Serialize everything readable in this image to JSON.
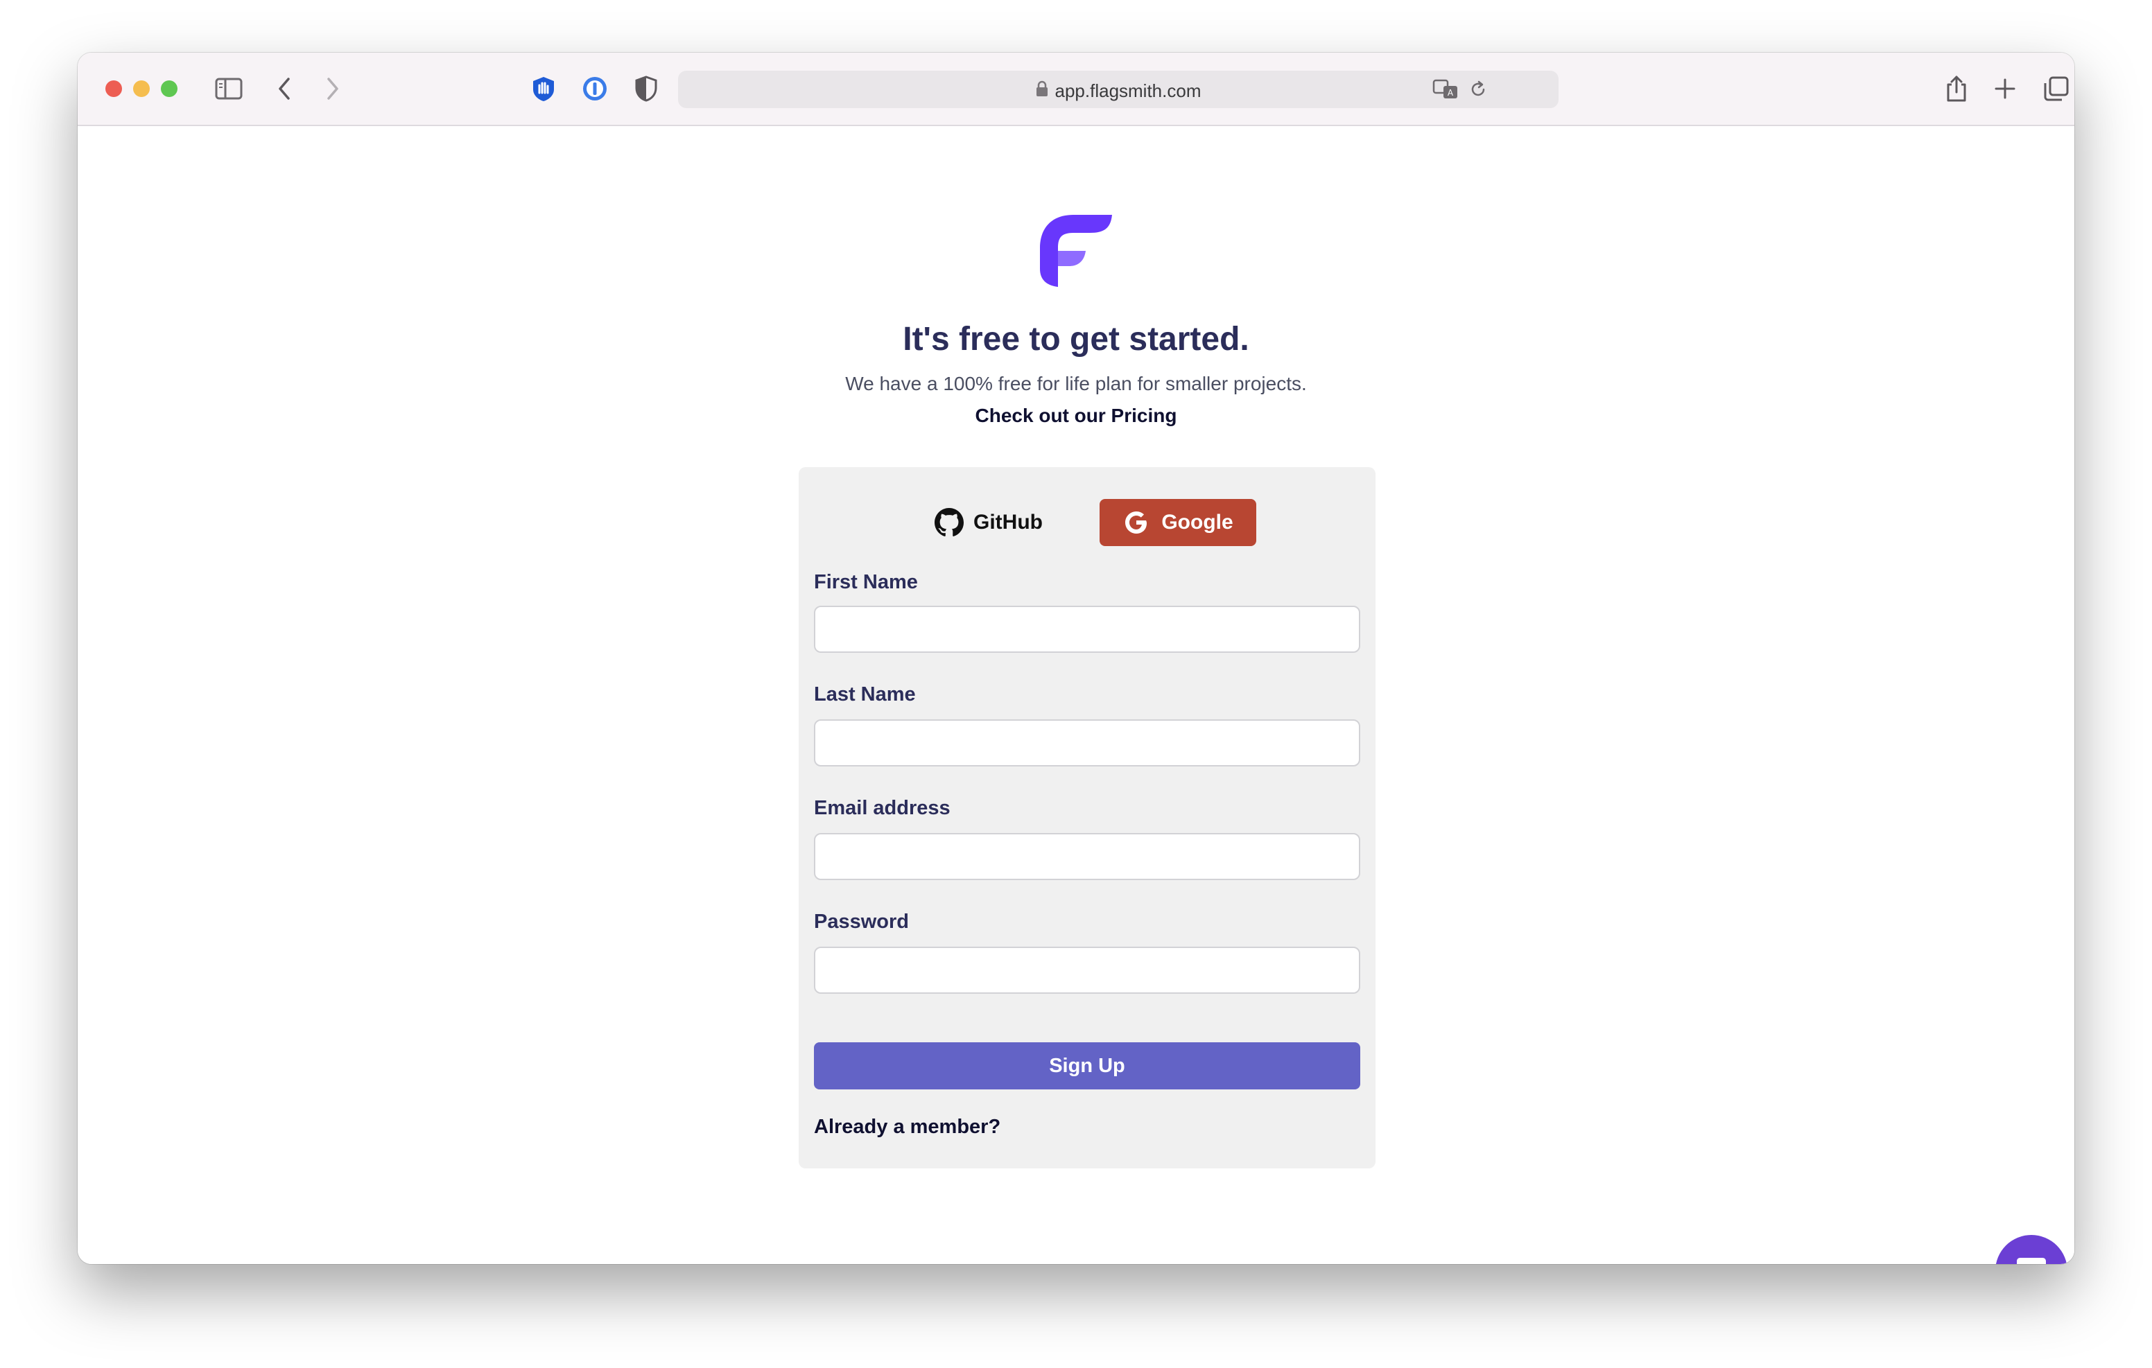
{
  "browser": {
    "url": "app.flagsmith.com",
    "icons": [
      "sidebar-icon",
      "back-icon",
      "forward-icon",
      "ublock-icon",
      "onepassword-icon",
      "shield-icon",
      "lock-icon",
      "translate-icon",
      "reload-icon",
      "share-icon",
      "new-tab-icon",
      "tabs-overview-icon"
    ]
  },
  "page": {
    "headline": "It's free to get started.",
    "subline": "We have a 100% free for life plan for smaller projects.",
    "pricing_link": "Check out our Pricing",
    "brand_color": "#6837fc"
  },
  "oauth": {
    "github_label": "GitHub",
    "google_label": "Google",
    "google_color": "#b84632"
  },
  "form": {
    "first_name": {
      "label": "First Name",
      "value": ""
    },
    "last_name": {
      "label": "Last Name",
      "value": ""
    },
    "email": {
      "label": "Email address",
      "value": ""
    },
    "password": {
      "label": "Password",
      "value": ""
    },
    "submit_label": "Sign Up",
    "submit_color": "#6363c6",
    "member_link": "Already a member?"
  },
  "chat_widget": {
    "icon": "chat-icon",
    "color": "#6b3fd4"
  }
}
